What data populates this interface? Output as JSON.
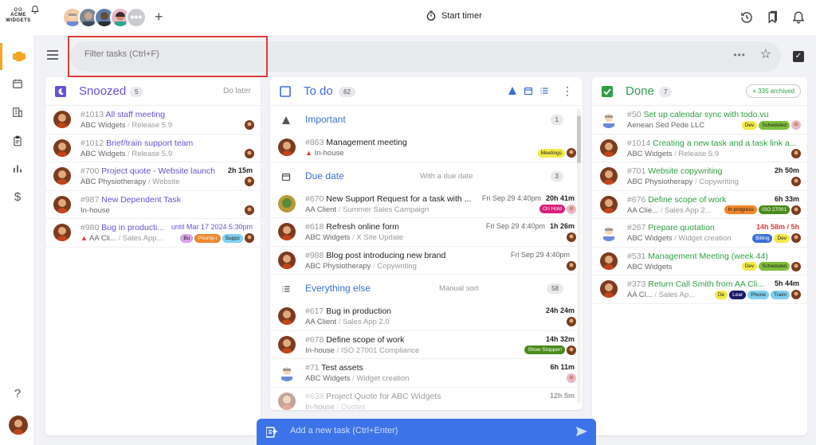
{
  "app": {
    "logo_line1": "ACME",
    "logo_line2": "WIDGETS",
    "more_avatars": "•••",
    "start_timer": "Start timer"
  },
  "filter": {
    "placeholder": "Filter tasks (Ctrl+F)",
    "more": "•••"
  },
  "colors": {
    "accent_blue": "#3d73e8",
    "done_green": "#2e9e44",
    "snoozed_purple": "#6a4fd8",
    "rail_active": "#f5a623"
  },
  "snoozed": {
    "title": "Snoozed",
    "count": "5",
    "hint": "Do later",
    "tasks": [
      {
        "num": "#1013",
        "name": "All staff meeting",
        "client": "ABC Widgets",
        "project": "Release 5.9",
        "right": ""
      },
      {
        "num": "#1012",
        "name": "Brief/train support team",
        "client": "ABC Widgets",
        "project": "Release 5.9",
        "right": ""
      },
      {
        "num": "#700",
        "name": "Project quote - Website launch",
        "client": "ABC Physiotherapy",
        "project": "Website",
        "right": "2h 15m"
      },
      {
        "num": "#987",
        "name": "New Dependent Task",
        "client": "In-house",
        "project": "",
        "right": ""
      },
      {
        "num": "#980",
        "name": "Bug in producti...",
        "client": "AA Cli...",
        "project": "Sales App...",
        "right": "until Mar 17 2024 5:30pm",
        "tags": [
          "Bu",
          "Priority-I",
          "Suppc"
        ]
      }
    ]
  },
  "todo": {
    "title": "To do",
    "count": "62",
    "sections": {
      "important": {
        "title": "Important",
        "count": "1"
      },
      "due": {
        "title": "Due date",
        "hint": "With a due date",
        "count": "3"
      },
      "else": {
        "title": "Everything else",
        "hint": "Manual sort",
        "count": "58"
      }
    },
    "important_tasks": [
      {
        "num": "#863",
        "name": "Management meeting",
        "client": "In-house",
        "tag": "Meetings"
      }
    ],
    "due_tasks": [
      {
        "num": "#670",
        "name": "New Support Request for a task with ...",
        "client": "AA Client",
        "project": "Summer Sales Campaign",
        "date": "Fri Sep 29 4:40pm",
        "time": "20h 41m",
        "tag": "On Hold"
      },
      {
        "num": "#618",
        "name": "Refresh online form",
        "client": "ABC Widgets",
        "project": "X Site Update",
        "date": "Fri Sep 29 4:40pm",
        "time": "1h 26m"
      },
      {
        "num": "#988",
        "name": "Blog post introducing new brand",
        "client": "ABC Physiotherapy",
        "project": "Copywriting",
        "date": "Fri Sep 29 4:40pm",
        "time": ""
      }
    ],
    "else_tasks": [
      {
        "num": "#617",
        "name": "Bug in production",
        "client": "AA Client",
        "project": "Sales App 2.0",
        "time": "24h 24m"
      },
      {
        "num": "#678",
        "name": "Define scope of work",
        "client": "In-house",
        "project": "ISO 27001 Compliance",
        "time": "14h 32m",
        "tag": "Show Stopper!"
      },
      {
        "num": "#71",
        "name": "Test assets",
        "client": "ABC Widgets",
        "project": "Widget creation",
        "time": "6h 11m"
      },
      {
        "num": "#638",
        "name": "Project Quote for ABC Widgets",
        "client": "In-house",
        "project": "Quotes",
        "time": "12h 5m"
      }
    ]
  },
  "done": {
    "title": "Done",
    "count": "7",
    "archived": "+ 335 archived",
    "tasks": [
      {
        "num": "#50",
        "name": "Set up calendar sync with todo.vu",
        "client": "Aenean Sed Pede LLC",
        "project": "",
        "right": "",
        "tags": [
          "Dev",
          "Scheduled"
        ]
      },
      {
        "num": "#1014",
        "name": "Creating a new task and a task link a...",
        "client": "ABC Widgets",
        "project": "Release 5.9",
        "right": ""
      },
      {
        "num": "#701",
        "name": "Website copywriting",
        "client": "ABC Physiotherapy",
        "project": "Copywriting",
        "right": "2h 50m"
      },
      {
        "num": "#676",
        "name": "Define scope of work",
        "client": "AA Clie...",
        "project": "Sales App 2...",
        "right": "6h 33m",
        "tags": [
          "In progress",
          "ISO 27001"
        ]
      },
      {
        "num": "#267",
        "name": "Prepare quotation",
        "client": "ABC Widgets",
        "project": "Widget creation",
        "right": "14h 58m / 5h",
        "tags": [
          "Billing",
          "Dev"
        ]
      },
      {
        "num": "#531",
        "name": "Management Meeting (week 44)",
        "client": "ABC Widgets",
        "project": "",
        "right": "",
        "tags": [
          "Dev",
          "Scheduled"
        ]
      },
      {
        "num": "#373",
        "name": "Return Call Smith from AA Cli...",
        "client": "AA Cl...",
        "project": "Sales Ap...",
        "right": "5h 44m",
        "tags": [
          "De",
          "Lear",
          "Phone",
          "Traini"
        ]
      }
    ]
  },
  "add_task": {
    "placeholder": "Add a new task (Ctrl+Enter)"
  },
  "help": "?"
}
